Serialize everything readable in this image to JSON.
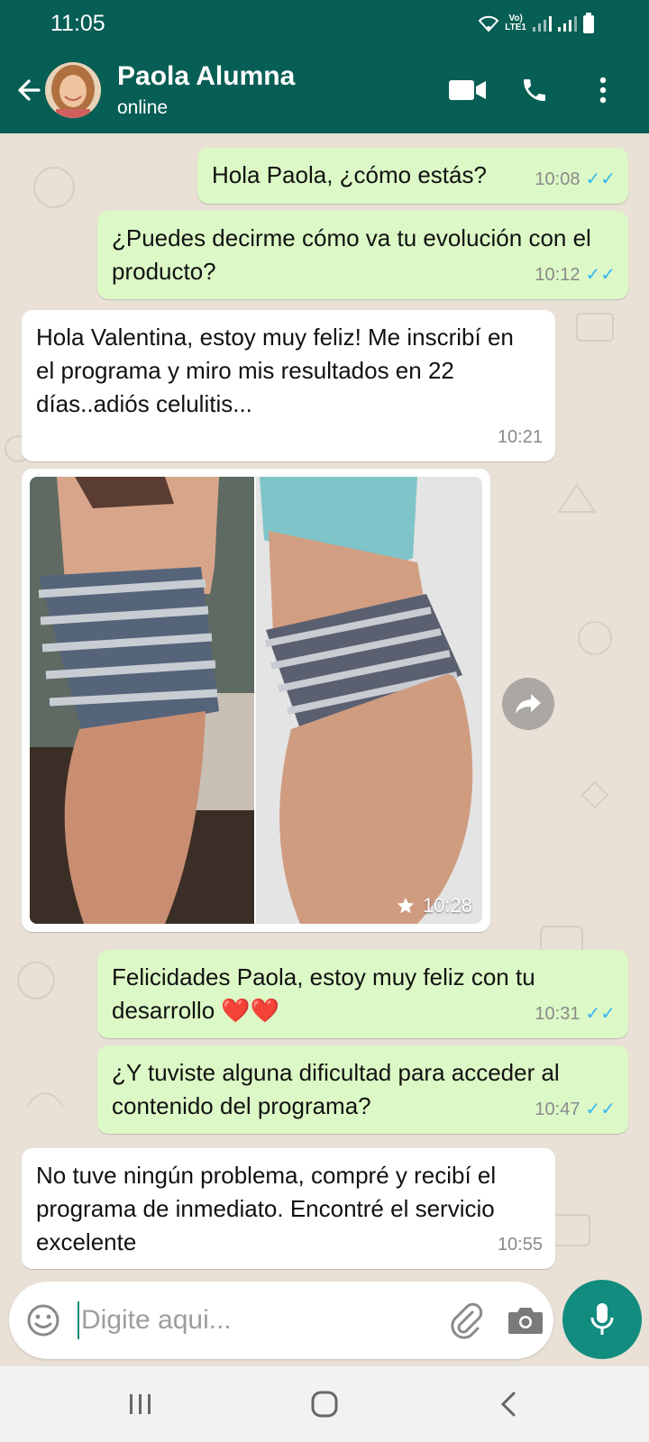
{
  "status_bar": {
    "time": "11:05",
    "network_label_top": "Vo)",
    "network_label_bottom": "LTE1"
  },
  "header": {
    "contact_name": "Paola Alumna",
    "contact_status": "online"
  },
  "messages": [
    {
      "direction": "outgoing",
      "text": "Hola Paola, ¿cómo estás?",
      "time": "10:08",
      "ticks": "✓✓"
    },
    {
      "direction": "outgoing",
      "text": "¿Puedes decirme cómo va tu evolución con el producto?",
      "time": "10:12",
      "ticks": "✓✓"
    },
    {
      "direction": "incoming",
      "text": "Hola Valentina, estoy muy feliz!  Me inscribí en el programa y miro mis resultados en 22 días..adiós celulitis...",
      "time": "10:21"
    },
    {
      "direction": "incoming",
      "type": "image",
      "time": "10:28",
      "starred": true
    },
    {
      "direction": "outgoing",
      "text": "Felicidades Paola, estoy muy feliz con tu desarrollo ❤️❤️",
      "time": "10:31",
      "ticks": "✓✓"
    },
    {
      "direction": "outgoing",
      "text": "¿Y tuviste alguna dificultad para acceder al contenido del programa?",
      "time": "10:47",
      "ticks": "✓✓"
    },
    {
      "direction": "incoming",
      "text": "No tuve ningún problema, compré y recibí el programa de inmediato.  Encontré el servicio excelente",
      "time": "10:55"
    }
  ],
  "input": {
    "placeholder": "Digite aqui..."
  },
  "colors": {
    "header": "#075e54",
    "outgoing_bubble": "#dcf8c6",
    "incoming_bubble": "#ffffff",
    "accent": "#128c7e",
    "read_ticks": "#34b7f1"
  },
  "icons": [
    "back-arrow-icon",
    "video-call-icon",
    "phone-icon",
    "more-options-icon",
    "forward-icon",
    "star-icon",
    "emoji-icon",
    "attach-icon",
    "camera-icon",
    "mic-icon",
    "recent-apps-icon",
    "home-icon",
    "nav-back-icon"
  ]
}
